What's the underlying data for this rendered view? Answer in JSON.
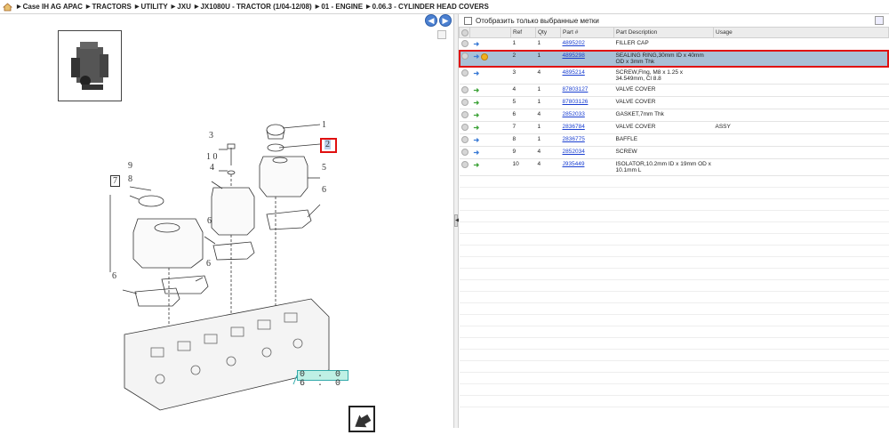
{
  "breadcrumb": [
    "Case IH AG APAC",
    "TRACTORS",
    "UTILITY",
    "JXU",
    "JX1080U - TRACTOR (1/04-12/08)",
    "01 - ENGINE",
    "0.06.3 - CYLINDER HEAD COVERS"
  ],
  "diagram": {
    "labels": [
      "1",
      "2",
      "3",
      "1 0",
      "4",
      "5",
      "6",
      "7",
      "8",
      "9",
      "6",
      "6",
      "6"
    ],
    "code": "0 . 0 6 . 0"
  },
  "parts": {
    "filter_label": "Отобразить только выбранные метки",
    "headers": [
      "Ref",
      "Qty",
      "Part #",
      "Part Description",
      "Usage"
    ],
    "rows": [
      {
        "ref": "1",
        "qty": "1",
        "pn": "4895202",
        "desc": "FILLER CAP",
        "usage": "",
        "arrow": "blue"
      },
      {
        "ref": "2",
        "qty": "1",
        "pn": "4895298",
        "desc": "SEALING RING,30mm ID x 40mm OD x 3mm Thk",
        "usage": "",
        "arrow": "blue",
        "selected": true
      },
      {
        "ref": "3",
        "qty": "4",
        "pn": "4895214",
        "desc": "SCREW,Flng, M8 x 1.25 x 34.549mm, Cl 8.8",
        "usage": "",
        "arrow": "blue"
      },
      {
        "ref": "4",
        "qty": "1",
        "pn": "87803127",
        "desc": "VALVE COVER",
        "usage": "",
        "arrow": "green"
      },
      {
        "ref": "5",
        "qty": "1",
        "pn": "87803126",
        "desc": "VALVE COVER",
        "usage": "",
        "arrow": "green"
      },
      {
        "ref": "6",
        "qty": "4",
        "pn": "2852033",
        "desc": "GASKET,7mm Thk",
        "usage": "",
        "arrow": "green"
      },
      {
        "ref": "7",
        "qty": "1",
        "pn": "2836784",
        "desc": "VALVE COVER",
        "usage": "ASSY",
        "arrow": "green"
      },
      {
        "ref": "8",
        "qty": "1",
        "pn": "2836775",
        "desc": "BAFFLE",
        "usage": "",
        "arrow": "blue"
      },
      {
        "ref": "9",
        "qty": "4",
        "pn": "2852034",
        "desc": "SCREW",
        "usage": "",
        "arrow": "blue"
      },
      {
        "ref": "10",
        "qty": "4",
        "pn": "J935449",
        "desc": "ISOLATOR,10.2mm ID x 19mm OD x 10.1mm L",
        "usage": "",
        "arrow": "green"
      }
    ]
  },
  "colors": {
    "selected_row": "#a9c0d6",
    "highlight": "#e01010",
    "link": "#1a3fd1"
  }
}
